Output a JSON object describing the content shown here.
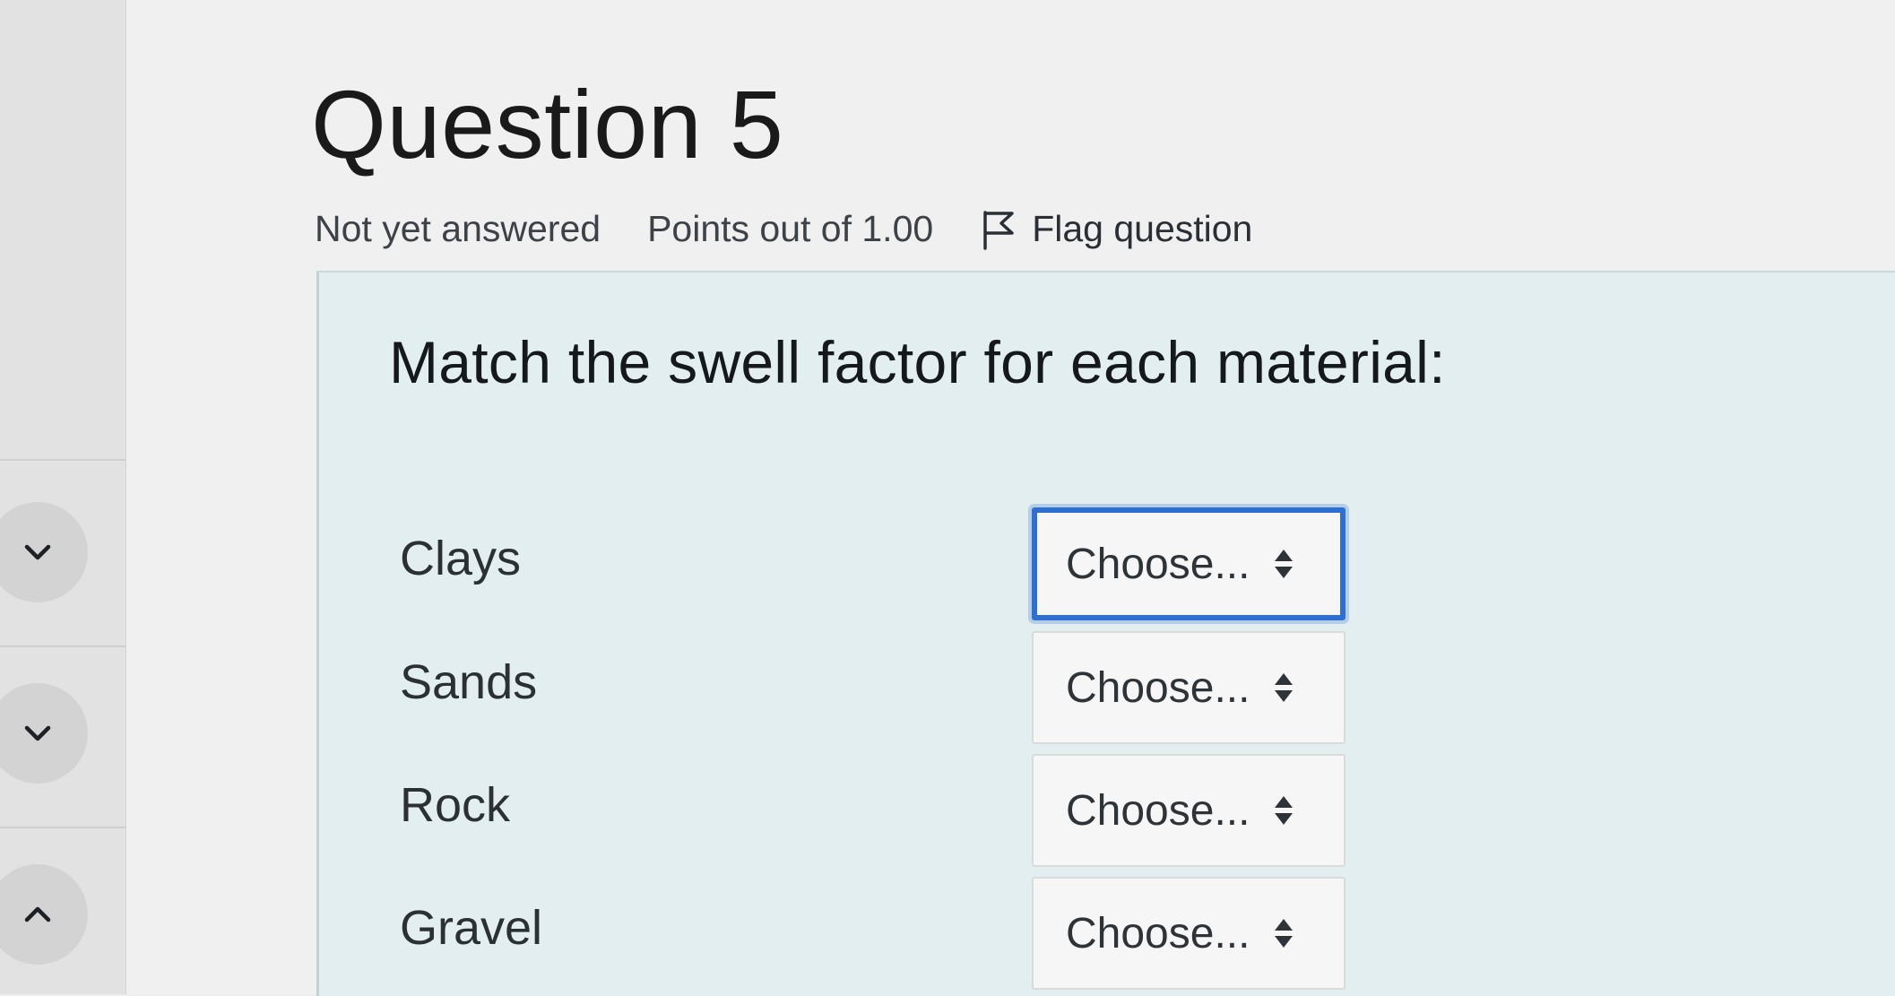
{
  "sidebar": {
    "buttons": [
      {
        "icon": "chevron-down-icon"
      },
      {
        "icon": "chevron-down-icon"
      },
      {
        "icon": "chevron-up-icon"
      }
    ]
  },
  "question": {
    "title": "Question 5",
    "status": "Not yet answered",
    "points": "Points out of 1.00",
    "flag_label": "Flag question",
    "flag_icon": "flag-icon",
    "prompt": "Match the swell factor for each material:",
    "rows": [
      {
        "label": "Clays",
        "selected": "Choose..."
      },
      {
        "label": "Sands",
        "selected": "Choose..."
      },
      {
        "label": "Rock",
        "selected": "Choose..."
      },
      {
        "label": "Gravel",
        "selected": "Choose..."
      }
    ]
  },
  "colors": {
    "focus_ring": "#2f6fd0",
    "question_bg": "#e2eef0"
  }
}
